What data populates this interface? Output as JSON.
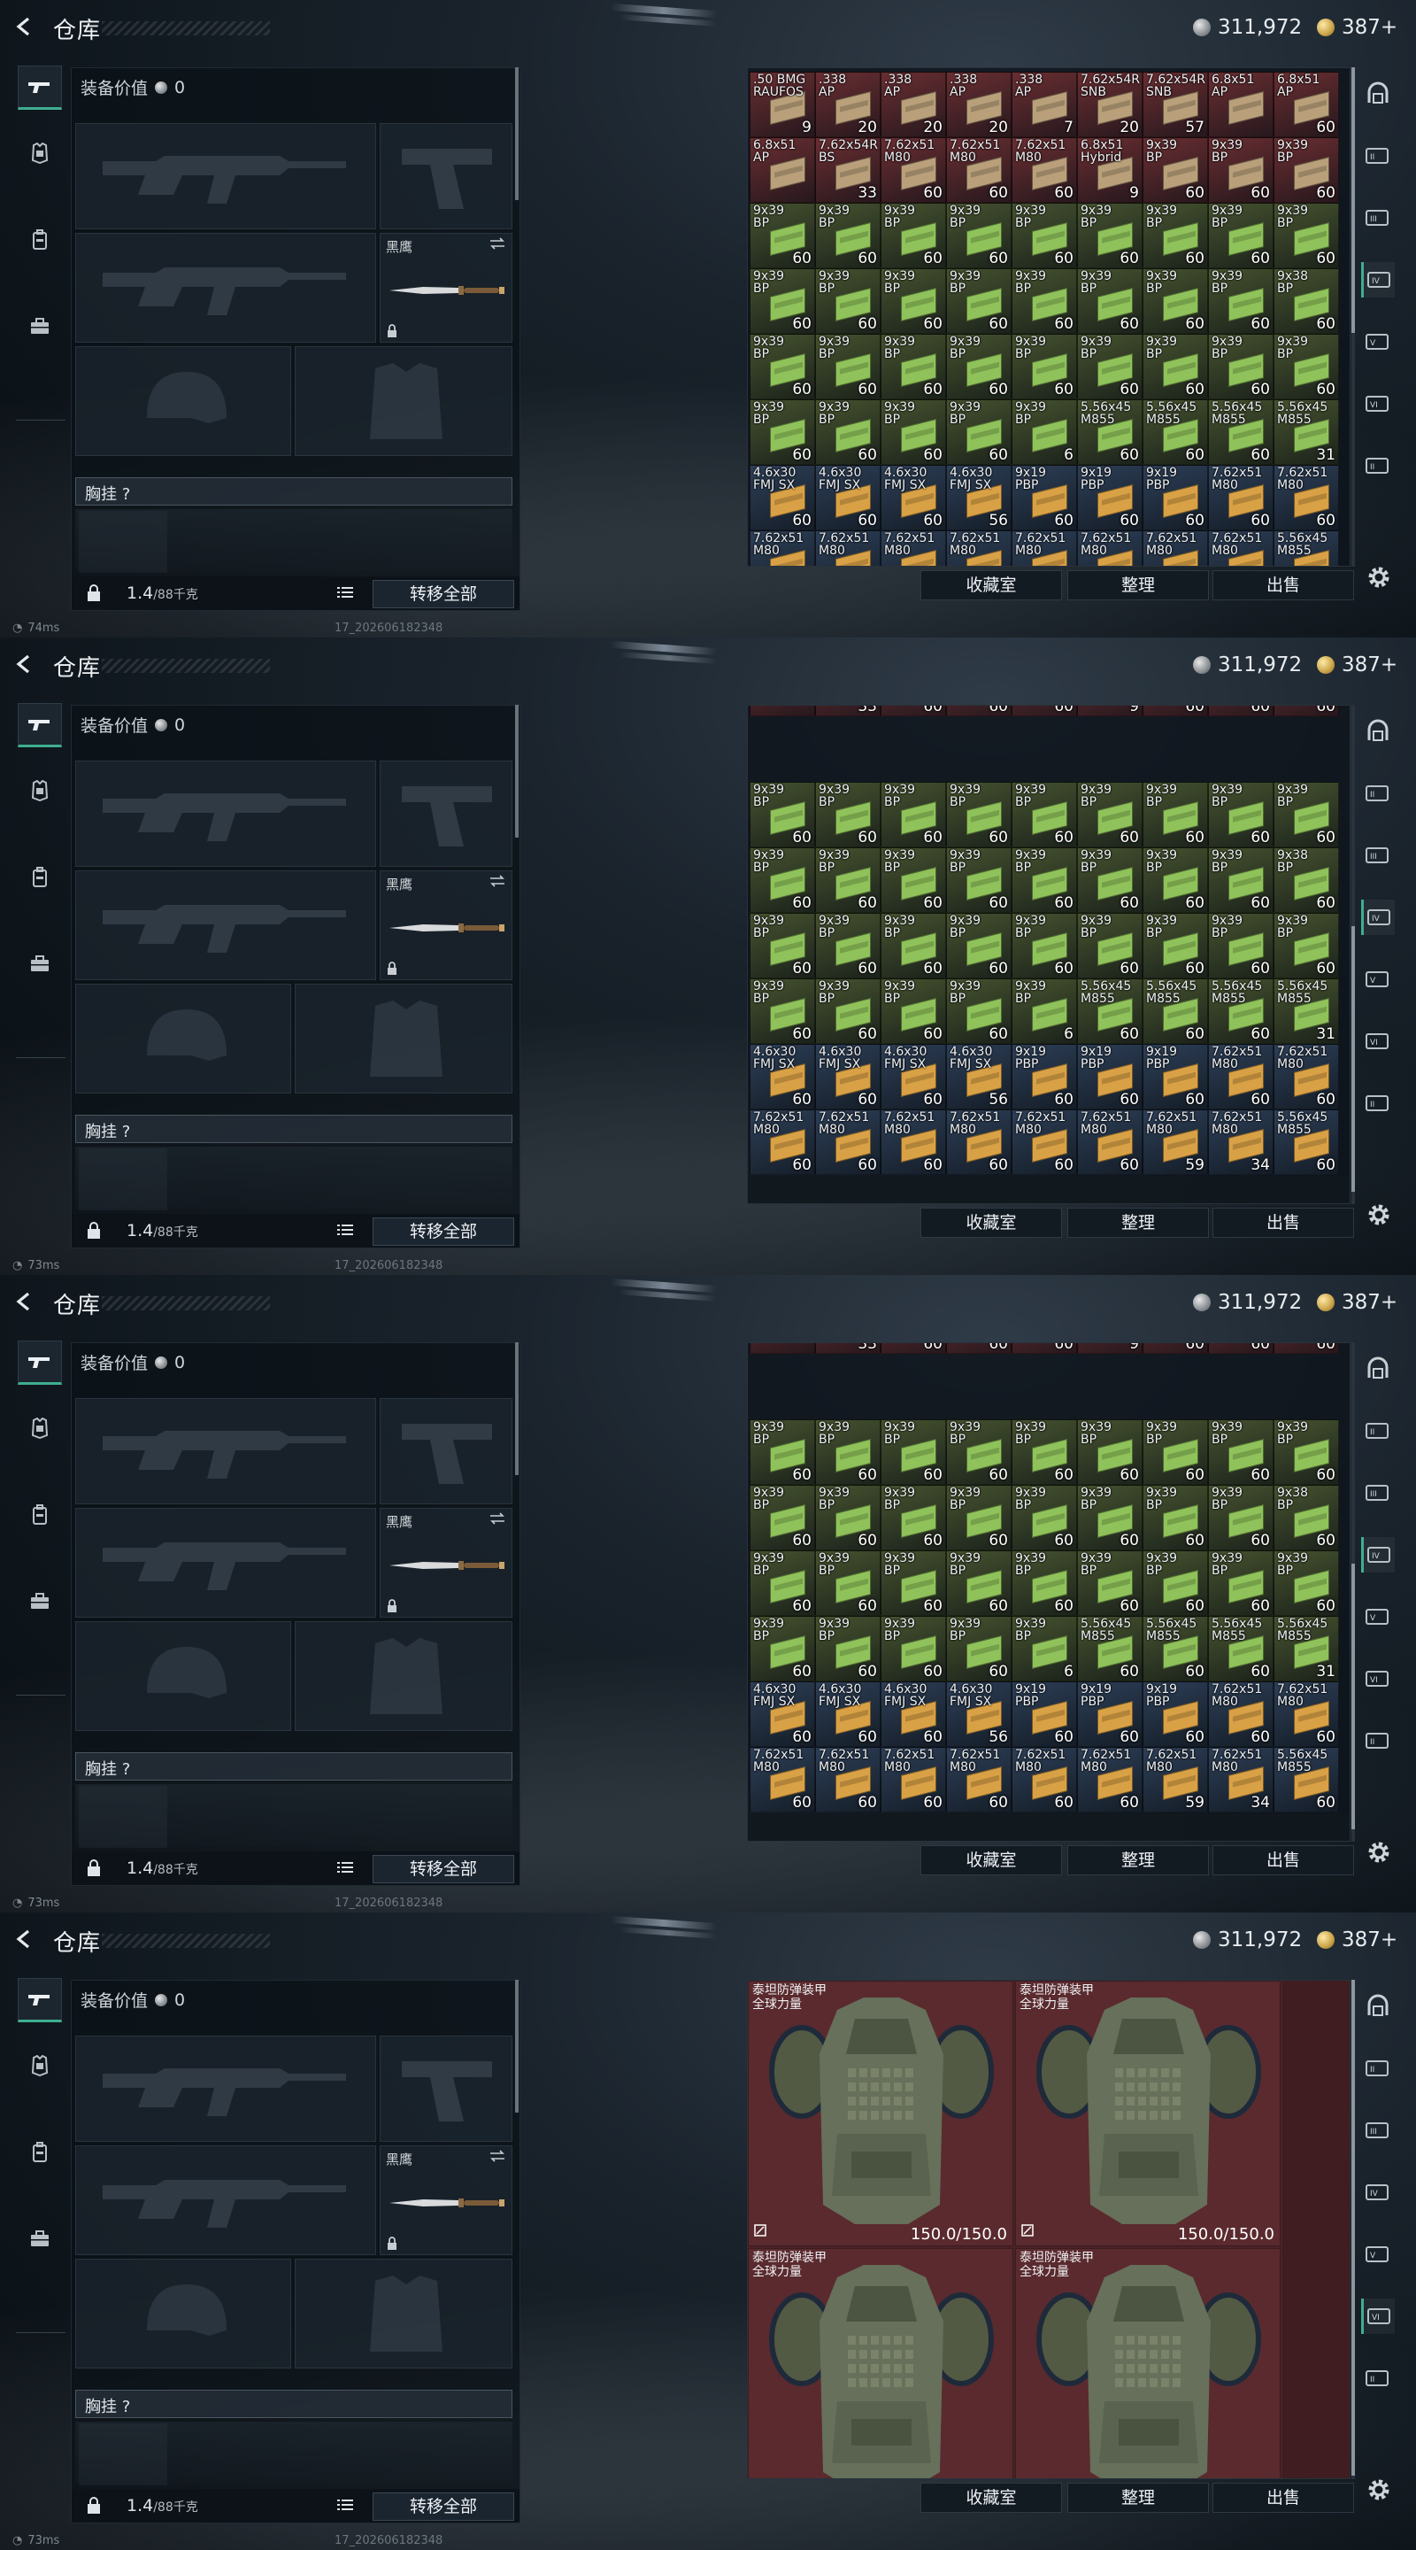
{
  "header": {
    "title": "仓库",
    "silver": "311,972",
    "gold": "387+"
  },
  "equip": {
    "value_label": "装备价值",
    "value": "0",
    "melee_name": "黑鹰",
    "chest_label": "胸挂",
    "chest_hint": "?",
    "weight": "1.4",
    "weight_max": "/88千克",
    "transfer_all": "转移全部"
  },
  "inventory_buttons": {
    "collection": "收藏室",
    "sort": "整理",
    "sell": "出售"
  },
  "status": {
    "ping_1": "74ms",
    "ping_2": "73ms",
    "ping_3": "73ms",
    "ping_4": "73ms",
    "build": "17_202606182348"
  },
  "colors": {
    "accent": "#3fae90",
    "red_bg": "#6a2e32",
    "green_bg": "#46532f",
    "blue_bg": "#2d3f57",
    "armor_bg": "#5a2a2e"
  },
  "icons": {
    "back": "back-arrow-icon",
    "weapon": "gun-icon",
    "helmet": "armor-icon",
    "backpack": "backpack-icon",
    "case": "briefcase-icon",
    "settings": "gear-icon",
    "lock": "lock-icon",
    "list": "list-icon",
    "swap": "swap-icon"
  },
  "ammo_rows": [
    [
      {
        "n": ".50 BMG\nRAUFOS",
        "c": "9",
        "t": "red"
      },
      {
        "n": ".338\nAP",
        "c": "20",
        "t": "red"
      },
      {
        "n": ".338\nAP",
        "c": "20",
        "t": "red"
      },
      {
        "n": ".338\nAP",
        "c": "20",
        "t": "red"
      },
      {
        "n": ".338\nAP",
        "c": "7",
        "t": "red"
      },
      {
        "n": "7.62x54R\nSNB",
        "c": "20",
        "t": "red"
      },
      {
        "n": "7.62x54R\nSNB",
        "c": "57",
        "t": "red"
      },
      {
        "n": "6.8x51\nAP",
        "c": "",
        "t": "red"
      },
      {
        "n": "6.8x51\nAP",
        "c": "60",
        "t": "red"
      }
    ],
    [
      {
        "n": "6.8x51\nAP",
        "c": "",
        "t": "red"
      },
      {
        "n": "7.62x54R\nBS",
        "c": "33",
        "t": "red"
      },
      {
        "n": "7.62x51\nM80",
        "c": "60",
        "t": "red"
      },
      {
        "n": "7.62x51\nM80",
        "c": "60",
        "t": "red"
      },
      {
        "n": "7.62x51\nM80",
        "c": "60",
        "t": "red"
      },
      {
        "n": "6.8x51\nHybrid",
        "c": "9",
        "t": "red"
      },
      {
        "n": "9x39\nBP",
        "c": "60",
        "t": "red"
      },
      {
        "n": "9x39\nBP",
        "c": "60",
        "t": "red"
      },
      {
        "n": "9x39\nBP",
        "c": "60",
        "t": "red"
      }
    ],
    [
      {
        "n": "9x39\nBP",
        "c": "60",
        "t": "green"
      },
      {
        "n": "9x39\nBP",
        "c": "60",
        "t": "green"
      },
      {
        "n": "9x39\nBP",
        "c": "60",
        "t": "green"
      },
      {
        "n": "9x39\nBP",
        "c": "60",
        "t": "green"
      },
      {
        "n": "9x39\nBP",
        "c": "60",
        "t": "green"
      },
      {
        "n": "9x39\nBP",
        "c": "60",
        "t": "green"
      },
      {
        "n": "9x39\nBP",
        "c": "60",
        "t": "green"
      },
      {
        "n": "9x39\nBP",
        "c": "60",
        "t": "green"
      },
      {
        "n": "9x39\nBP",
        "c": "60",
        "t": "green"
      }
    ],
    [
      {
        "n": "9x39\nBP",
        "c": "60",
        "t": "green"
      },
      {
        "n": "9x39\nBP",
        "c": "60",
        "t": "green"
      },
      {
        "n": "9x39\nBP",
        "c": "60",
        "t": "green"
      },
      {
        "n": "9x39\nBP",
        "c": "60",
        "t": "green"
      },
      {
        "n": "9x39\nBP",
        "c": "60",
        "t": "green"
      },
      {
        "n": "9x39\nBP",
        "c": "60",
        "t": "green"
      },
      {
        "n": "9x39\nBP",
        "c": "60",
        "t": "green"
      },
      {
        "n": "9x39\nBP",
        "c": "60",
        "t": "green"
      },
      {
        "n": "9x38\nBP",
        "c": "60",
        "t": "green"
      }
    ],
    [
      {
        "n": "9x39\nBP",
        "c": "60",
        "t": "green"
      },
      {
        "n": "9x39\nBP",
        "c": "60",
        "t": "green"
      },
      {
        "n": "9x39\nBP",
        "c": "60",
        "t": "green"
      },
      {
        "n": "9x39\nBP",
        "c": "60",
        "t": "green"
      },
      {
        "n": "9x39\nBP",
        "c": "60",
        "t": "green"
      },
      {
        "n": "9x39\nBP",
        "c": "60",
        "t": "green"
      },
      {
        "n": "9x39\nBP",
        "c": "60",
        "t": "green"
      },
      {
        "n": "9x39\nBP",
        "c": "60",
        "t": "green"
      },
      {
        "n": "9x39\nBP",
        "c": "60",
        "t": "green"
      }
    ],
    [
      {
        "n": "9x39\nBP",
        "c": "60",
        "t": "green"
      },
      {
        "n": "9x39\nBP",
        "c": "60",
        "t": "green"
      },
      {
        "n": "9x39\nBP",
        "c": "60",
        "t": "green"
      },
      {
        "n": "9x39\nBP",
        "c": "60",
        "t": "green"
      },
      {
        "n": "9x39\nBP",
        "c": "6",
        "t": "green"
      },
      {
        "n": "5.56x45\nM855",
        "c": "60",
        "t": "green"
      },
      {
        "n": "5.56x45\nM855",
        "c": "60",
        "t": "green"
      },
      {
        "n": "5.56x45\nM855",
        "c": "60",
        "t": "green"
      },
      {
        "n": "5.56x45\nM855",
        "c": "31",
        "t": "green"
      }
    ],
    [
      {
        "n": "4.6x30\nFMJ SX",
        "c": "60",
        "t": "blue"
      },
      {
        "n": "4.6x30\nFMJ SX",
        "c": "60",
        "t": "blue"
      },
      {
        "n": "4.6x30\nFMJ SX",
        "c": "60",
        "t": "blue"
      },
      {
        "n": "4.6x30\nFMJ SX",
        "c": "56",
        "t": "blue"
      },
      {
        "n": "9x19\nPBP",
        "c": "60",
        "t": "blue"
      },
      {
        "n": "9x19\nPBP",
        "c": "60",
        "t": "blue"
      },
      {
        "n": "9x19\nPBP",
        "c": "60",
        "t": "blue"
      },
      {
        "n": "7.62x51\nM80",
        "c": "60",
        "t": "blue"
      },
      {
        "n": "7.62x51\nM80",
        "c": "60",
        "t": "blue"
      }
    ],
    [
      {
        "n": "7.62x51\nM80",
        "c": "60",
        "t": "blue"
      },
      {
        "n": "7.62x51\nM80",
        "c": "60",
        "t": "blue"
      },
      {
        "n": "7.62x51\nM80",
        "c": "60",
        "t": "blue"
      },
      {
        "n": "7.62x51\nM80",
        "c": "60",
        "t": "blue"
      },
      {
        "n": "7.62x51\nM80",
        "c": "60",
        "t": "blue"
      },
      {
        "n": "7.62x51\nM80",
        "c": "60",
        "t": "blue"
      },
      {
        "n": "7.62x51\nM80",
        "c": "59",
        "t": "blue"
      },
      {
        "n": "7.62x51\nM80",
        "c": "34",
        "t": "blue"
      },
      {
        "n": "5.56x45\nM855",
        "c": "60",
        "t": "blue"
      }
    ]
  ],
  "scrolled_top_row": [
    {
      "c": "",
      "t": "red"
    },
    {
      "c": "33",
      "t": "red"
    },
    {
      "c": "60",
      "t": "red"
    },
    {
      "c": "60",
      "t": "red"
    },
    {
      "c": "60",
      "t": "red"
    },
    {
      "c": "9",
      "t": "red"
    },
    {
      "c": "60",
      "t": "red"
    },
    {
      "c": "60",
      "t": "red"
    },
    {
      "c": "60",
      "t": "red"
    }
  ],
  "armor_items": [
    {
      "n": "泰坦防弹装甲\n全球力量",
      "dur": "150.0/150.0"
    },
    {
      "n": "泰坦防弹装甲\n全球力量",
      "dur": "150.0/150.0"
    },
    {
      "n": "泰坦防弹装甲\n全球力量",
      "dur": ""
    },
    {
      "n": "泰坦防弹装甲\n全球力量",
      "dur": ""
    }
  ],
  "rail_labels": [
    "II",
    "III",
    "IV",
    "V",
    "VI"
  ]
}
